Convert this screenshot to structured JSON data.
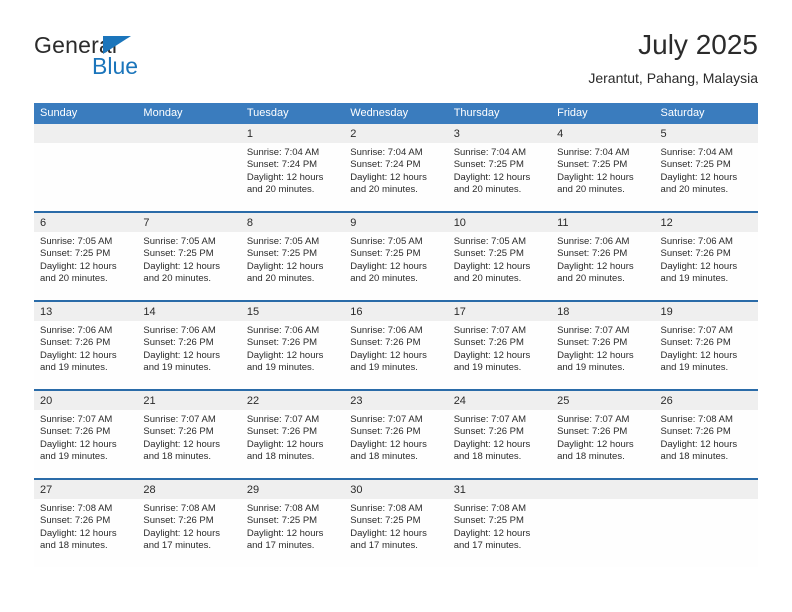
{
  "brand": {
    "name_part1": "General",
    "name_part2": "Blue",
    "accent_color": "#1b75bb"
  },
  "header": {
    "title": "July 2025",
    "location": "Jerantut, Pahang, Malaysia"
  },
  "calendar": {
    "header_color": "#3a7cbe",
    "weekdays": [
      "Sunday",
      "Monday",
      "Tuesday",
      "Wednesday",
      "Thursday",
      "Friday",
      "Saturday"
    ],
    "weeks": [
      [
        {
          "day": "",
          "lines": []
        },
        {
          "day": "",
          "lines": []
        },
        {
          "day": "1",
          "lines": [
            "Sunrise: 7:04 AM",
            "Sunset: 7:24 PM",
            "Daylight: 12 hours",
            "and 20 minutes."
          ]
        },
        {
          "day": "2",
          "lines": [
            "Sunrise: 7:04 AM",
            "Sunset: 7:24 PM",
            "Daylight: 12 hours",
            "and 20 minutes."
          ]
        },
        {
          "day": "3",
          "lines": [
            "Sunrise: 7:04 AM",
            "Sunset: 7:25 PM",
            "Daylight: 12 hours",
            "and 20 minutes."
          ]
        },
        {
          "day": "4",
          "lines": [
            "Sunrise: 7:04 AM",
            "Sunset: 7:25 PM",
            "Daylight: 12 hours",
            "and 20 minutes."
          ]
        },
        {
          "day": "5",
          "lines": [
            "Sunrise: 7:04 AM",
            "Sunset: 7:25 PM",
            "Daylight: 12 hours",
            "and 20 minutes."
          ]
        }
      ],
      [
        {
          "day": "6",
          "lines": [
            "Sunrise: 7:05 AM",
            "Sunset: 7:25 PM",
            "Daylight: 12 hours",
            "and 20 minutes."
          ]
        },
        {
          "day": "7",
          "lines": [
            "Sunrise: 7:05 AM",
            "Sunset: 7:25 PM",
            "Daylight: 12 hours",
            "and 20 minutes."
          ]
        },
        {
          "day": "8",
          "lines": [
            "Sunrise: 7:05 AM",
            "Sunset: 7:25 PM",
            "Daylight: 12 hours",
            "and 20 minutes."
          ]
        },
        {
          "day": "9",
          "lines": [
            "Sunrise: 7:05 AM",
            "Sunset: 7:25 PM",
            "Daylight: 12 hours",
            "and 20 minutes."
          ]
        },
        {
          "day": "10",
          "lines": [
            "Sunrise: 7:05 AM",
            "Sunset: 7:25 PM",
            "Daylight: 12 hours",
            "and 20 minutes."
          ]
        },
        {
          "day": "11",
          "lines": [
            "Sunrise: 7:06 AM",
            "Sunset: 7:26 PM",
            "Daylight: 12 hours",
            "and 20 minutes."
          ]
        },
        {
          "day": "12",
          "lines": [
            "Sunrise: 7:06 AM",
            "Sunset: 7:26 PM",
            "Daylight: 12 hours",
            "and 19 minutes."
          ]
        }
      ],
      [
        {
          "day": "13",
          "lines": [
            "Sunrise: 7:06 AM",
            "Sunset: 7:26 PM",
            "Daylight: 12 hours",
            "and 19 minutes."
          ]
        },
        {
          "day": "14",
          "lines": [
            "Sunrise: 7:06 AM",
            "Sunset: 7:26 PM",
            "Daylight: 12 hours",
            "and 19 minutes."
          ]
        },
        {
          "day": "15",
          "lines": [
            "Sunrise: 7:06 AM",
            "Sunset: 7:26 PM",
            "Daylight: 12 hours",
            "and 19 minutes."
          ]
        },
        {
          "day": "16",
          "lines": [
            "Sunrise: 7:06 AM",
            "Sunset: 7:26 PM",
            "Daylight: 12 hours",
            "and 19 minutes."
          ]
        },
        {
          "day": "17",
          "lines": [
            "Sunrise: 7:07 AM",
            "Sunset: 7:26 PM",
            "Daylight: 12 hours",
            "and 19 minutes."
          ]
        },
        {
          "day": "18",
          "lines": [
            "Sunrise: 7:07 AM",
            "Sunset: 7:26 PM",
            "Daylight: 12 hours",
            "and 19 minutes."
          ]
        },
        {
          "day": "19",
          "lines": [
            "Sunrise: 7:07 AM",
            "Sunset: 7:26 PM",
            "Daylight: 12 hours",
            "and 19 minutes."
          ]
        }
      ],
      [
        {
          "day": "20",
          "lines": [
            "Sunrise: 7:07 AM",
            "Sunset: 7:26 PM",
            "Daylight: 12 hours",
            "and 19 minutes."
          ]
        },
        {
          "day": "21",
          "lines": [
            "Sunrise: 7:07 AM",
            "Sunset: 7:26 PM",
            "Daylight: 12 hours",
            "and 18 minutes."
          ]
        },
        {
          "day": "22",
          "lines": [
            "Sunrise: 7:07 AM",
            "Sunset: 7:26 PM",
            "Daylight: 12 hours",
            "and 18 minutes."
          ]
        },
        {
          "day": "23",
          "lines": [
            "Sunrise: 7:07 AM",
            "Sunset: 7:26 PM",
            "Daylight: 12 hours",
            "and 18 minutes."
          ]
        },
        {
          "day": "24",
          "lines": [
            "Sunrise: 7:07 AM",
            "Sunset: 7:26 PM",
            "Daylight: 12 hours",
            "and 18 minutes."
          ]
        },
        {
          "day": "25",
          "lines": [
            "Sunrise: 7:07 AM",
            "Sunset: 7:26 PM",
            "Daylight: 12 hours",
            "and 18 minutes."
          ]
        },
        {
          "day": "26",
          "lines": [
            "Sunrise: 7:08 AM",
            "Sunset: 7:26 PM",
            "Daylight: 12 hours",
            "and 18 minutes."
          ]
        }
      ],
      [
        {
          "day": "27",
          "lines": [
            "Sunrise: 7:08 AM",
            "Sunset: 7:26 PM",
            "Daylight: 12 hours",
            "and 18 minutes."
          ]
        },
        {
          "day": "28",
          "lines": [
            "Sunrise: 7:08 AM",
            "Sunset: 7:26 PM",
            "Daylight: 12 hours",
            "and 17 minutes."
          ]
        },
        {
          "day": "29",
          "lines": [
            "Sunrise: 7:08 AM",
            "Sunset: 7:25 PM",
            "Daylight: 12 hours",
            "and 17 minutes."
          ]
        },
        {
          "day": "30",
          "lines": [
            "Sunrise: 7:08 AM",
            "Sunset: 7:25 PM",
            "Daylight: 12 hours",
            "and 17 minutes."
          ]
        },
        {
          "day": "31",
          "lines": [
            "Sunrise: 7:08 AM",
            "Sunset: 7:25 PM",
            "Daylight: 12 hours",
            "and 17 minutes."
          ]
        },
        {
          "day": "",
          "lines": []
        },
        {
          "day": "",
          "lines": []
        }
      ]
    ]
  }
}
